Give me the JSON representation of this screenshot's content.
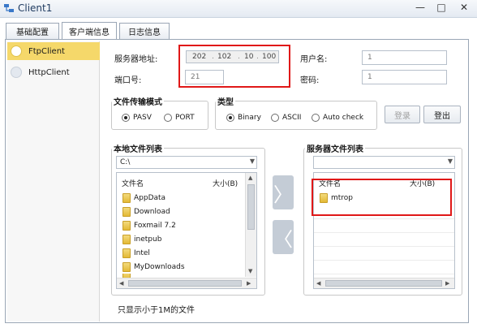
{
  "window": {
    "title": "Client1",
    "minimize": "—",
    "maximize": "□",
    "close": "✕"
  },
  "tabs": [
    {
      "label": "基础配置"
    },
    {
      "label": "客户端信息"
    },
    {
      "label": "日志信息"
    }
  ],
  "left_list": [
    {
      "label": "FtpClient"
    },
    {
      "label": "HttpClient"
    }
  ],
  "form": {
    "server_addr_label": "服务器地址:",
    "server_ip": [
      "202",
      "102",
      "10",
      "100"
    ],
    "port_label": "端口号:",
    "port_value": "21",
    "user_label": "用户名:",
    "user_value": "1",
    "password_label": "密码:",
    "password_value": "1"
  },
  "transfer_mode": {
    "title": "文件传输模式",
    "options": [
      "PASV",
      "PORT"
    ],
    "selected": "PASV"
  },
  "type_group": {
    "title": "类型",
    "options": [
      "Binary",
      "ASCII",
      "Auto check"
    ],
    "selected": "Binary"
  },
  "buttons": {
    "login": "登录",
    "logout": "登出"
  },
  "local_files": {
    "title": "本地文件列表",
    "path": "C:\\",
    "col_name": "文件名",
    "col_size": "大小(B)",
    "rows": [
      "AppData",
      "Download",
      "Foxmail 7.2",
      "inetpub",
      "Intel",
      "MyDownloads"
    ]
  },
  "server_files": {
    "title": "服务器文件列表",
    "path": "",
    "col_name": "文件名",
    "col_size": "大小(B)",
    "rows": [
      "mtrop"
    ]
  },
  "transfer": {
    "upload_icon": "chevron-right-icon",
    "download_icon": "chevron-left-icon",
    "upload_glyph": "〉",
    "download_glyph": "〈"
  },
  "footer_note": "只显示小于1M的文件",
  "colors": {
    "highlight": "#e01818",
    "selected_item": "#f5d86a"
  }
}
